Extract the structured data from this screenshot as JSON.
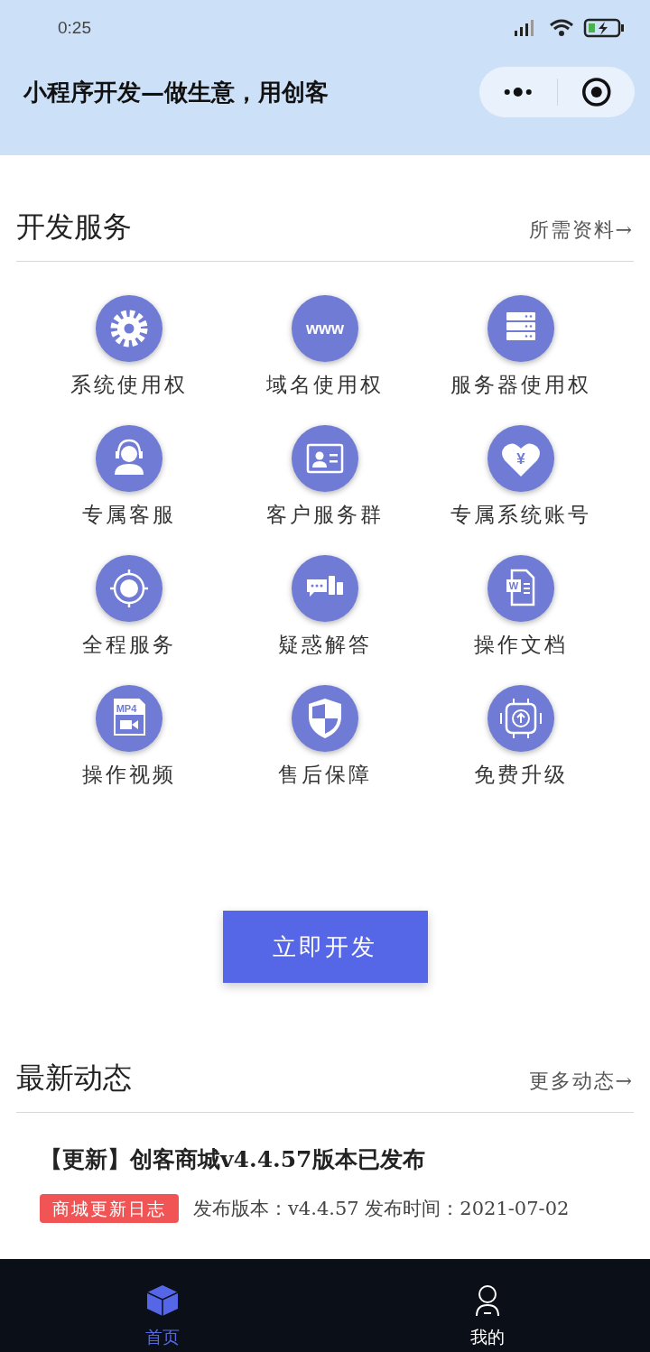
{
  "status_bar": {
    "time": "0:25"
  },
  "header": {
    "title": "小程序开发—做生意，用创客"
  },
  "services": {
    "title": "开发服务",
    "link": "所需资料→",
    "items": [
      {
        "kind": "gear",
        "label": "系统使用权"
      },
      {
        "kind": "www",
        "label": "域名使用权",
        "icon_text": "www"
      },
      {
        "kind": "server",
        "label": "服务器使用权"
      },
      {
        "kind": "headset",
        "label": "专属客服"
      },
      {
        "kind": "idcard",
        "label": "客户服务群"
      },
      {
        "kind": "heart",
        "label": "专属系统账号",
        "icon_text": "¥"
      },
      {
        "kind": "target",
        "label": "全程服务"
      },
      {
        "kind": "chat",
        "label": "疑惑解答"
      },
      {
        "kind": "doc",
        "label": "操作文档",
        "icon_text": "W"
      },
      {
        "kind": "video",
        "label": "操作视频",
        "icon_text": "MP4"
      },
      {
        "kind": "shield",
        "label": "售后保障"
      },
      {
        "kind": "chip",
        "label": "免费升级"
      }
    ]
  },
  "develop_button": "立即开发",
  "news": {
    "title": "最新动态",
    "link": "更多动态→",
    "items": [
      {
        "title": "【更新】创客商城v4.4.57版本已发布",
        "tag": "商城更新日志",
        "meta": "发布版本：v4.4.57 发布时间：2021-07-02"
      }
    ]
  },
  "tabs": [
    {
      "label": "首页",
      "kind": "home",
      "selected": true
    },
    {
      "label": "我的",
      "kind": "profile",
      "selected": false
    }
  ]
}
